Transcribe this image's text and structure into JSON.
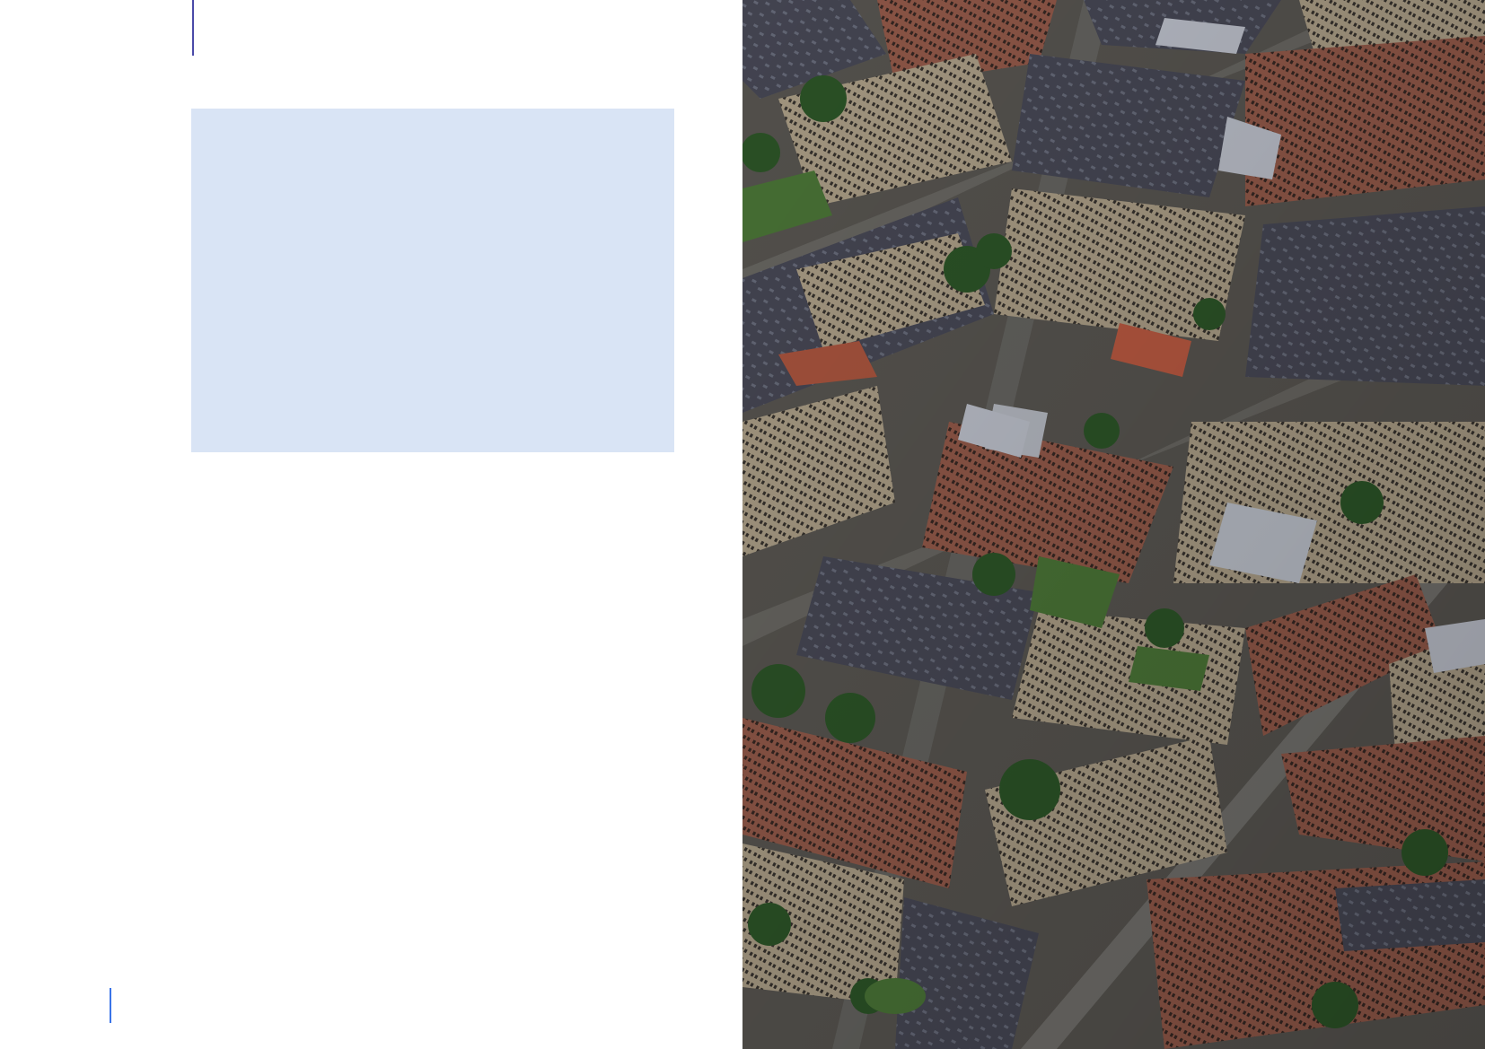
{
  "page": {
    "left_panel_color": "#ffffff",
    "box_color": "#d9e4f5",
    "top_rule_color": "#4a4aa8",
    "bottom_rule_color": "#3a74e8"
  },
  "photo": {
    "icon": "aerial-city-photo",
    "subject": ""
  }
}
